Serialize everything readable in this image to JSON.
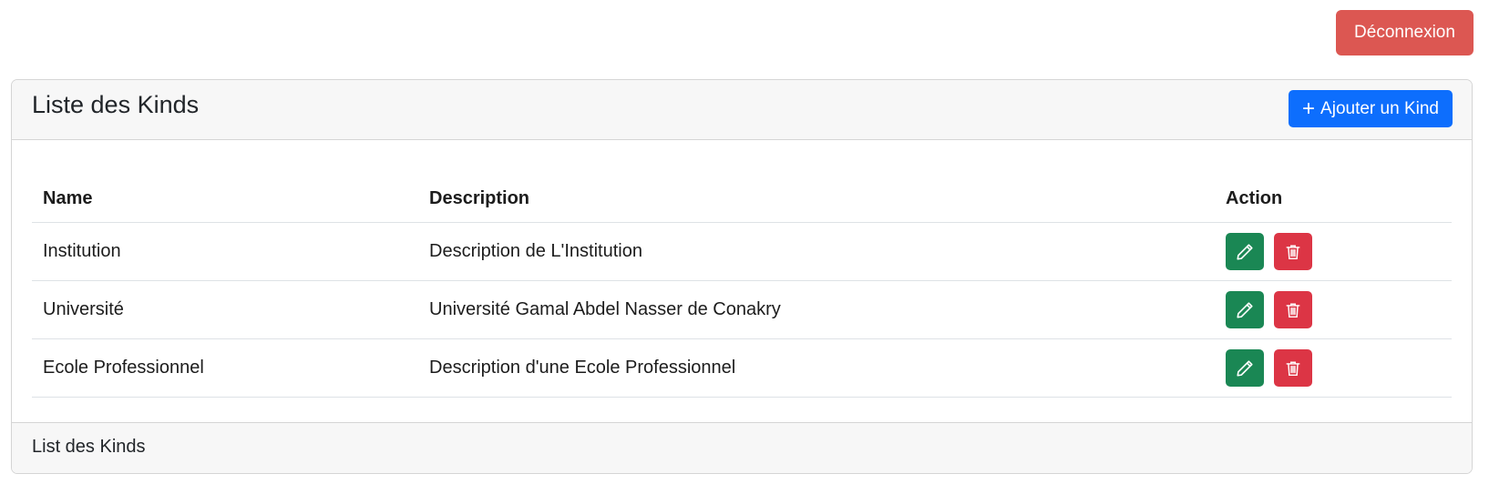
{
  "header": {
    "logout_label": "Déconnexion"
  },
  "card": {
    "title": "Liste des Kinds",
    "add_button_label": "Ajouter un Kind",
    "add_icon": "plus-icon",
    "footer_text": "List des Kinds"
  },
  "table": {
    "columns": [
      "Name",
      "Description",
      "Action"
    ],
    "rows": [
      {
        "name": "Institution",
        "description": "Description de L'Institution"
      },
      {
        "name": "Université",
        "description": "Université Gamal Abdel Nasser de Conakry"
      },
      {
        "name": "Ecole Professionnel",
        "description": "Description d'une Ecole Professionnel"
      }
    ],
    "edit_icon": "pencil-icon",
    "delete_icon": "trash-icon"
  },
  "colors": {
    "logout": "#dc5752",
    "primary": "#0d6efd",
    "edit": "#1a8754",
    "delete": "#dc3545",
    "header_bg": "#f7f7f7"
  }
}
